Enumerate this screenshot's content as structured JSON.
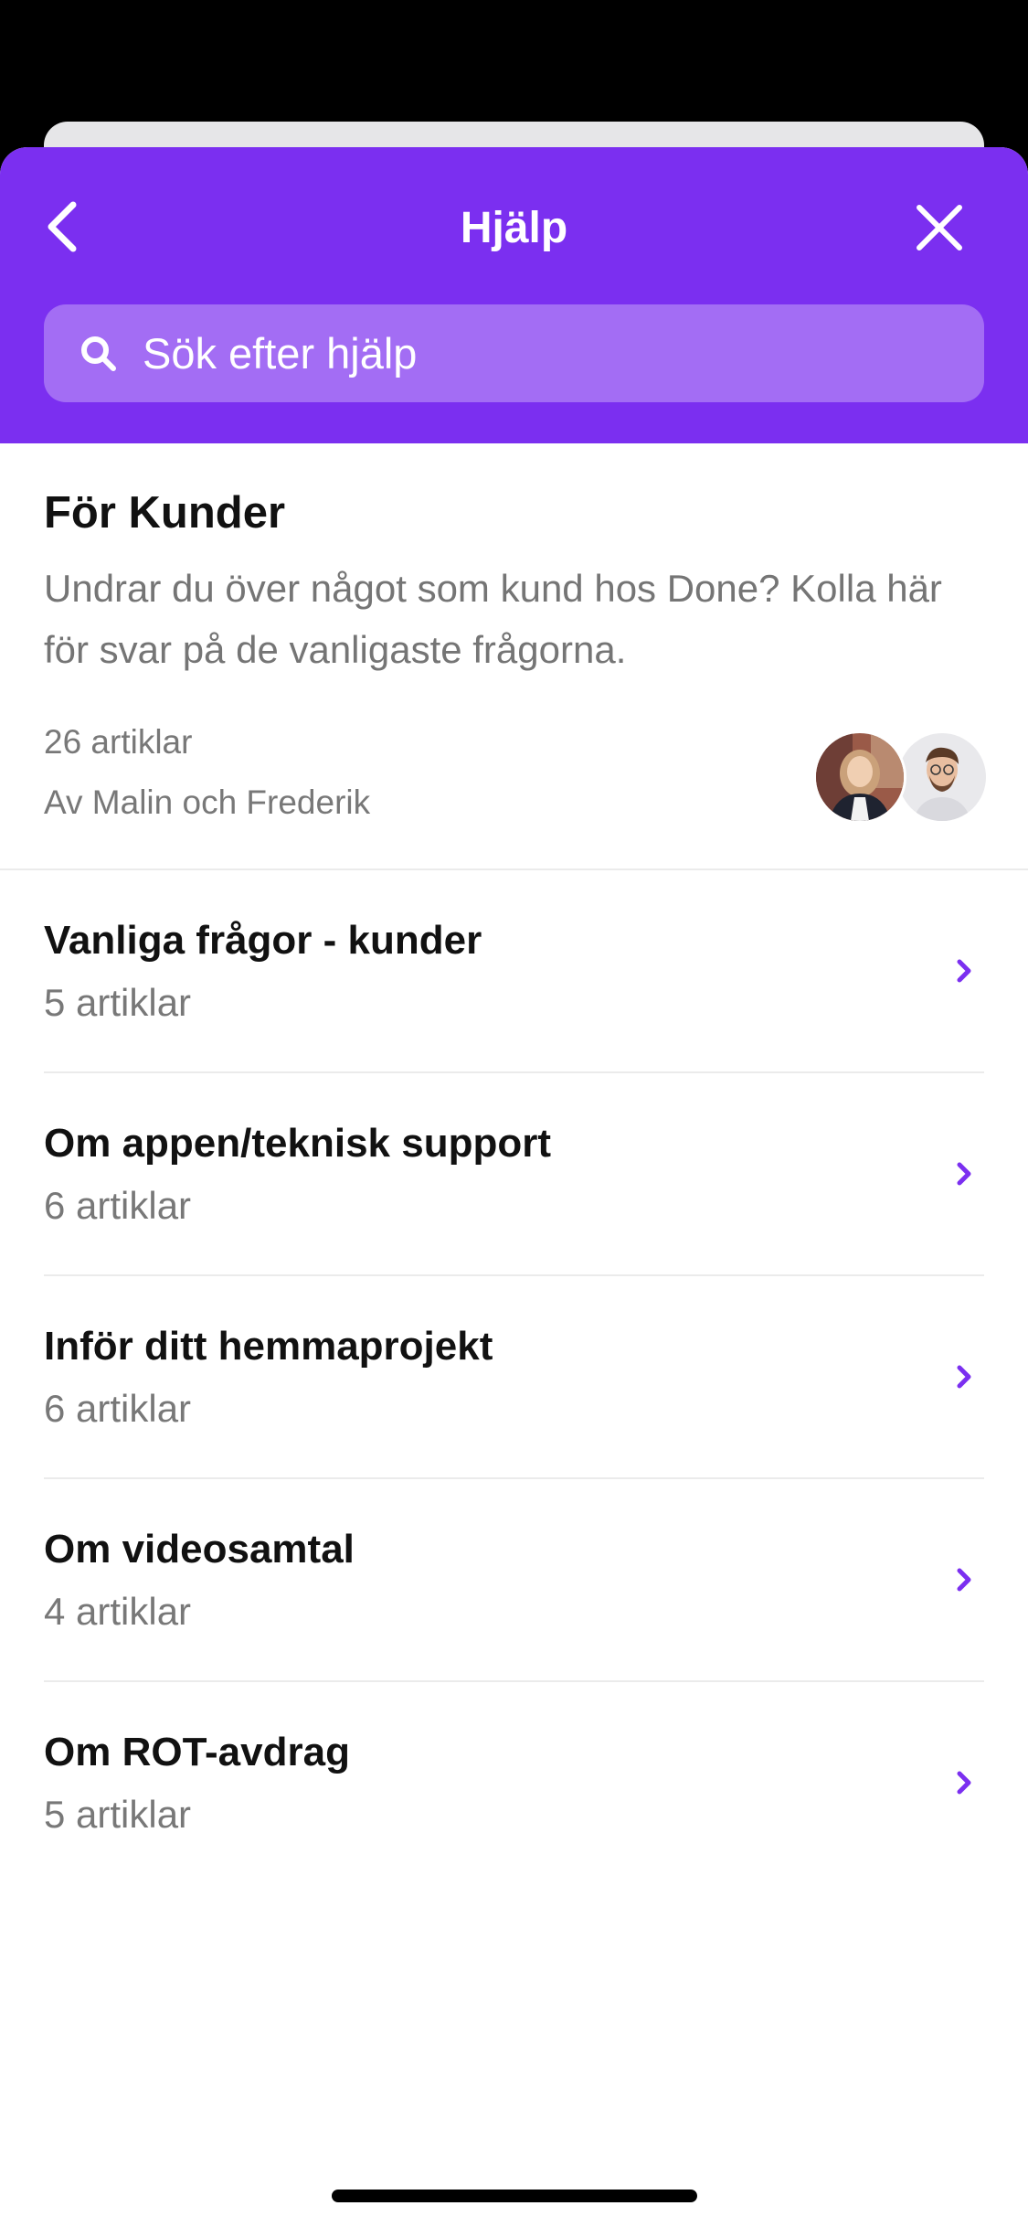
{
  "colors": {
    "accent": "#7b2ff0",
    "text_primary": "#111111",
    "text_secondary": "#787878"
  },
  "header": {
    "title": "Hjälp",
    "back_icon": "chevron-left-icon",
    "close_icon": "close-icon"
  },
  "search": {
    "placeholder": "Sök efter hjälp",
    "icon": "search-icon"
  },
  "collection": {
    "title": "För Kunder",
    "description": "Undrar du över något som kund hos Done? Kolla här för svar på de vanligaste frågorna.",
    "article_count": "26 artiklar",
    "authors": "Av Malin och Frederik"
  },
  "categories": [
    {
      "title": "Vanliga frågor - kunder",
      "count": "5 artiklar"
    },
    {
      "title": "Om appen/teknisk support",
      "count": "6 artiklar"
    },
    {
      "title": "Inför ditt hemmaprojekt",
      "count": "6 artiklar"
    },
    {
      "title": "Om videosamtal",
      "count": "4 artiklar"
    },
    {
      "title": "Om ROT-avdrag",
      "count": "5 artiklar"
    }
  ]
}
